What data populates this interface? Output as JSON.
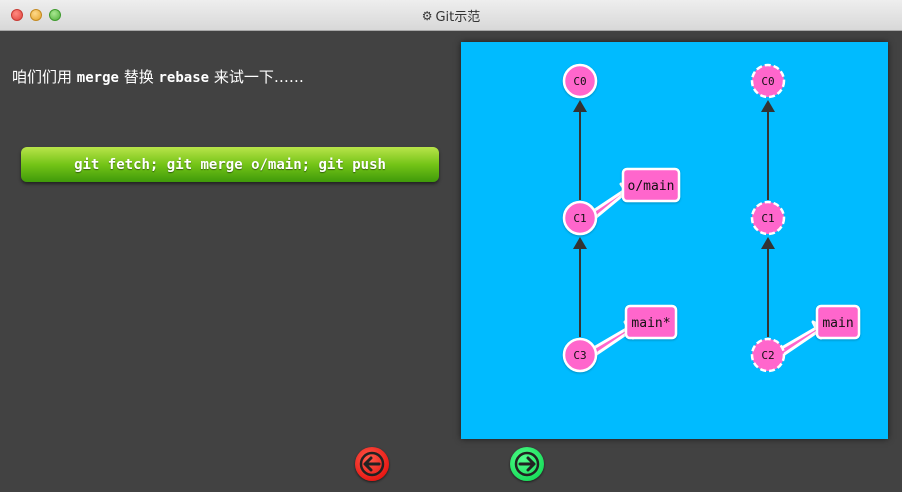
{
  "window": {
    "title": "Git示范"
  },
  "instruction": {
    "before": "咱们们用 ",
    "code1": "merge",
    "middle": " 替换 ",
    "code2": "rebase",
    "after": " 来试一下……"
  },
  "command_button": {
    "label": "git fetch; git merge o/main; git push"
  },
  "local_tree": {
    "commits": [
      "C0",
      "C1",
      "C3"
    ],
    "branches": [
      {
        "label": "o/main",
        "target": "C1"
      },
      {
        "label": "main*",
        "target": "C3"
      }
    ]
  },
  "remote_tree": {
    "commits": [
      "C0",
      "C1",
      "C2"
    ],
    "branches": [
      {
        "label": "main",
        "target": "C2"
      }
    ]
  },
  "colors": {
    "canvas": "#00bbff",
    "commit": "#ff66cc",
    "back_button": "#e00000",
    "forward_button": "#05d14a"
  },
  "icons": {
    "back": "arrow-left-icon",
    "forward": "arrow-right-icon",
    "title": "gear-icon"
  }
}
